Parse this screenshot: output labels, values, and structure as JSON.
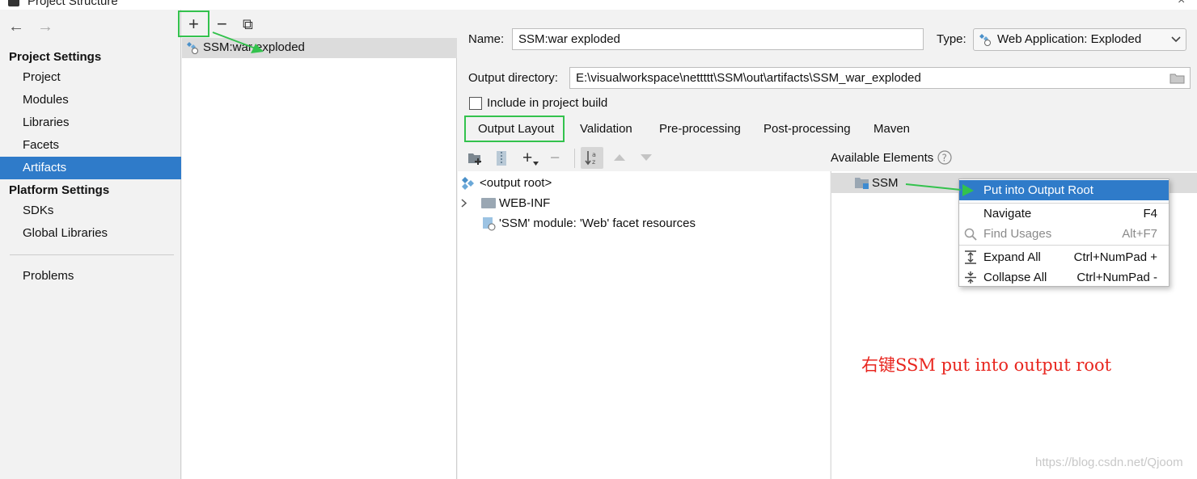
{
  "window": {
    "title": "Project Structure"
  },
  "sidebar": {
    "back_arrow": "←",
    "forward_arrow": "→",
    "project_settings_heading": "Project Settings",
    "project_items": [
      {
        "label": "Project"
      },
      {
        "label": "Modules"
      },
      {
        "label": "Libraries"
      },
      {
        "label": "Facets"
      },
      {
        "label": "Artifacts",
        "selected": true
      }
    ],
    "platform_settings_heading": "Platform Settings",
    "platform_items": [
      {
        "label": "SDKs"
      },
      {
        "label": "Global Libraries"
      }
    ],
    "problems_label": "Problems"
  },
  "artifacts_panel": {
    "toolbar": {
      "add": "+",
      "remove": "−",
      "copy": "⧉"
    },
    "items": [
      {
        "label": "SSM:war exploded",
        "icon": "web-facet-icon",
        "selected": true
      }
    ]
  },
  "editor": {
    "name_label": "Name:",
    "name_value": "SSM:war exploded",
    "type_label": "Type:",
    "type_value": "Web Application: Exploded",
    "output_dir_label": "Output directory:",
    "output_dir_value": "E:\\visualworkspace\\nettttt\\SSM\\out\\artifacts\\SSM_war_exploded",
    "include_build_label": "Include in project build",
    "include_build_checked": false,
    "tabs": [
      {
        "label": "Output Layout",
        "selected": true
      },
      {
        "label": "Validation"
      },
      {
        "label": "Pre-processing"
      },
      {
        "label": "Post-processing"
      },
      {
        "label": "Maven"
      }
    ],
    "tree": [
      {
        "label": "<output root>",
        "icon": "output-root-icon"
      },
      {
        "label": "WEB-INF",
        "icon": "folder-icon",
        "expandable": true
      },
      {
        "label": "'SSM' module: 'Web' facet resources",
        "icon": "web-resource-icon"
      }
    ],
    "available_label": "Available Elements",
    "available_items": [
      {
        "label": "SSM",
        "icon": "module-folder-icon"
      }
    ]
  },
  "context_menu": {
    "items": [
      {
        "label": "Put into Output Root",
        "shortcut": "",
        "highlighted": true
      },
      {
        "label": "Navigate",
        "shortcut": "F4"
      },
      {
        "label": "Find Usages",
        "shortcut": "Alt+F7",
        "disabled": true
      },
      {
        "label": "Expand All",
        "shortcut": "Ctrl+NumPad +"
      },
      {
        "label": "Collapse All",
        "shortcut": "Ctrl+NumPad -"
      }
    ]
  },
  "annotation": {
    "text": "右键SSM put into output root",
    "color": "#e8261f"
  },
  "watermark": "https://blog.csdn.net/Qjoom",
  "colors": {
    "selection": "#2f7bc9",
    "highlight_box": "#33c24d"
  }
}
